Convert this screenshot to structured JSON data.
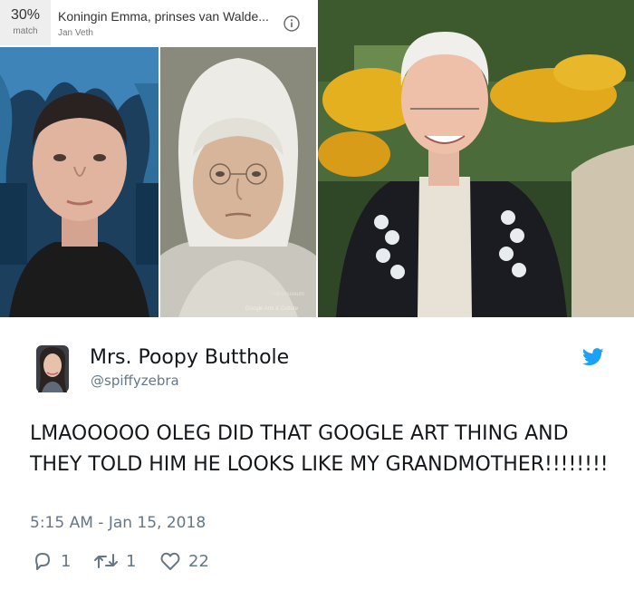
{
  "match": {
    "percent": "30%",
    "percent_label": "match",
    "artwork_title": "Koningin Emma, prinses van Walde...",
    "artist": "Jan Veth",
    "info_icon": "info-circle-icon"
  },
  "painting": {
    "museum_watermark": "Rijksmuseum",
    "credit_watermark": "Google Arts & Culture"
  },
  "tweet": {
    "display_name": "Mrs. Poopy Butthole",
    "handle": "@spiffyzebra",
    "text": "LMAOOOOO OLEG DID THAT GOOGLE ART THING AND THEY TOLD HIM HE LOOKS LIKE MY GRANDMOTHER!!!!!!!!",
    "timestamp": "5:15 AM - Jan 15, 2018",
    "reply_count": "1",
    "retweet_count": "1",
    "like_count": "22",
    "brand_icon": "twitter-bird-icon",
    "colors": {
      "brand": "#1da1f2",
      "text": "#14171a",
      "muted": "#657786"
    }
  }
}
